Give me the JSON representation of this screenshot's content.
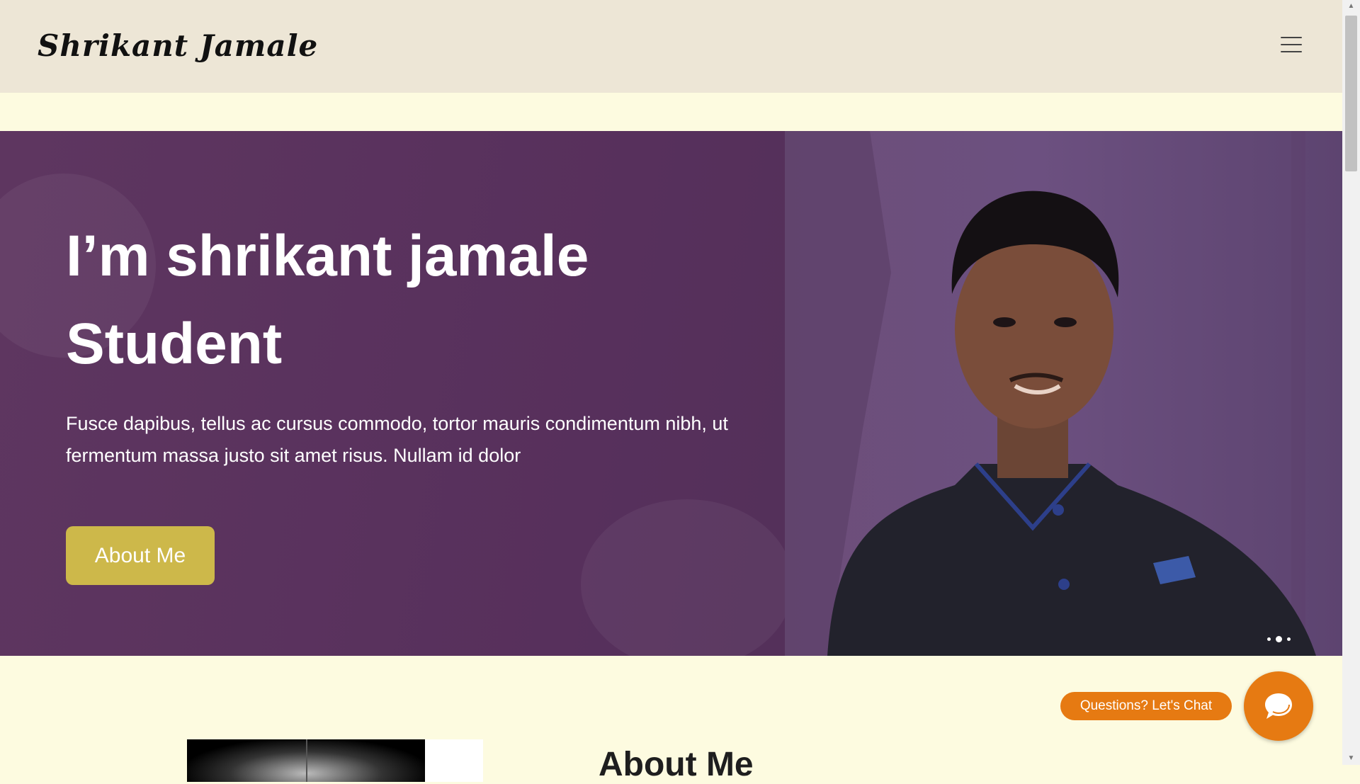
{
  "header": {
    "logo_text": "Shrikant Jamale",
    "menu_icon": "hamburger-menu-icon"
  },
  "hero": {
    "title_line1": "I’m shrikant jamale",
    "title_line2": "Student",
    "description": "Fusce dapibus, tellus ac cursus commodo, tortor mauris condimentum nibh, ut fermentum massa justo sit amet risus. Nullam id dolor",
    "button_label": "About Me",
    "slider_dots": 3,
    "active_slide": 2
  },
  "about_section": {
    "title": "About Me"
  },
  "chat": {
    "pill_label": "Questions? Let's Chat",
    "fab_icon": "chat-bubble-icon"
  },
  "colors": {
    "header_bg": "#ede6d6",
    "page_bg": "#fdfbe0",
    "hero_bg": "#57305c",
    "button_gold": "#cdb84a",
    "chat_orange": "#e67a12"
  }
}
